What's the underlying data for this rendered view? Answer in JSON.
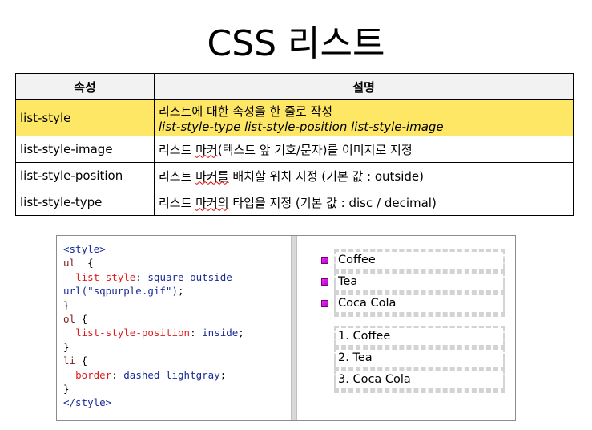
{
  "title": "CSS 리스트",
  "table": {
    "headers": [
      "속성",
      "설명"
    ],
    "rows": [
      {
        "prop": "list-style",
        "desc": "리스트에 대한 속성을 한 줄로 작성",
        "desc2": "list-style-type list-style-position list-style-image",
        "highlight": true
      },
      {
        "prop": "list-style-image",
        "desc_a": "리스트 ",
        "desc_b": "마커",
        "desc_c": "(텍스트 앞 기호/문자)를 이미지로 지정"
      },
      {
        "prop": "list-style-position",
        "desc_a": "리스트 ",
        "desc_b": "마커를",
        "desc_c": " 배치할 위치 지정 (기본 값 : outside)"
      },
      {
        "prop": "list-style-type",
        "desc_a": "리스트 ",
        "desc_b": "마커의",
        "desc_c": " 타입을 지정 (기본 값 : disc / decimal)"
      }
    ]
  },
  "code": {
    "l1": "<style>",
    "l2_sel": "ul",
    "l2_rest": "  {",
    "l3_prop": "list-style",
    "l3_val": "square outside",
    "l4_val": "url(\"sqpurple.gif\")",
    "l4_end": ";",
    "l5": "}",
    "l6_sel": "ol",
    "l6_rest": " {",
    "l7_prop": "list-style-position",
    "l7_val": "inside",
    "l7_end": ";",
    "l8": "}",
    "l9_sel": "li",
    "l9_rest": " {",
    "l10_prop": "border",
    "l10_val": "dashed lightgray",
    "l10_end": ";",
    "l11": "}",
    "l12": "</style>"
  },
  "preview": {
    "ul_items": [
      "Coffee",
      "Tea",
      "Coca Cola"
    ],
    "ol_items": [
      "1. Coffee",
      "2. Tea",
      "3. Coca Cola"
    ]
  },
  "colors": {
    "highlight": "#ffe766",
    "marker": "#cc00cc",
    "dashed_border": "#d3d3d3"
  }
}
